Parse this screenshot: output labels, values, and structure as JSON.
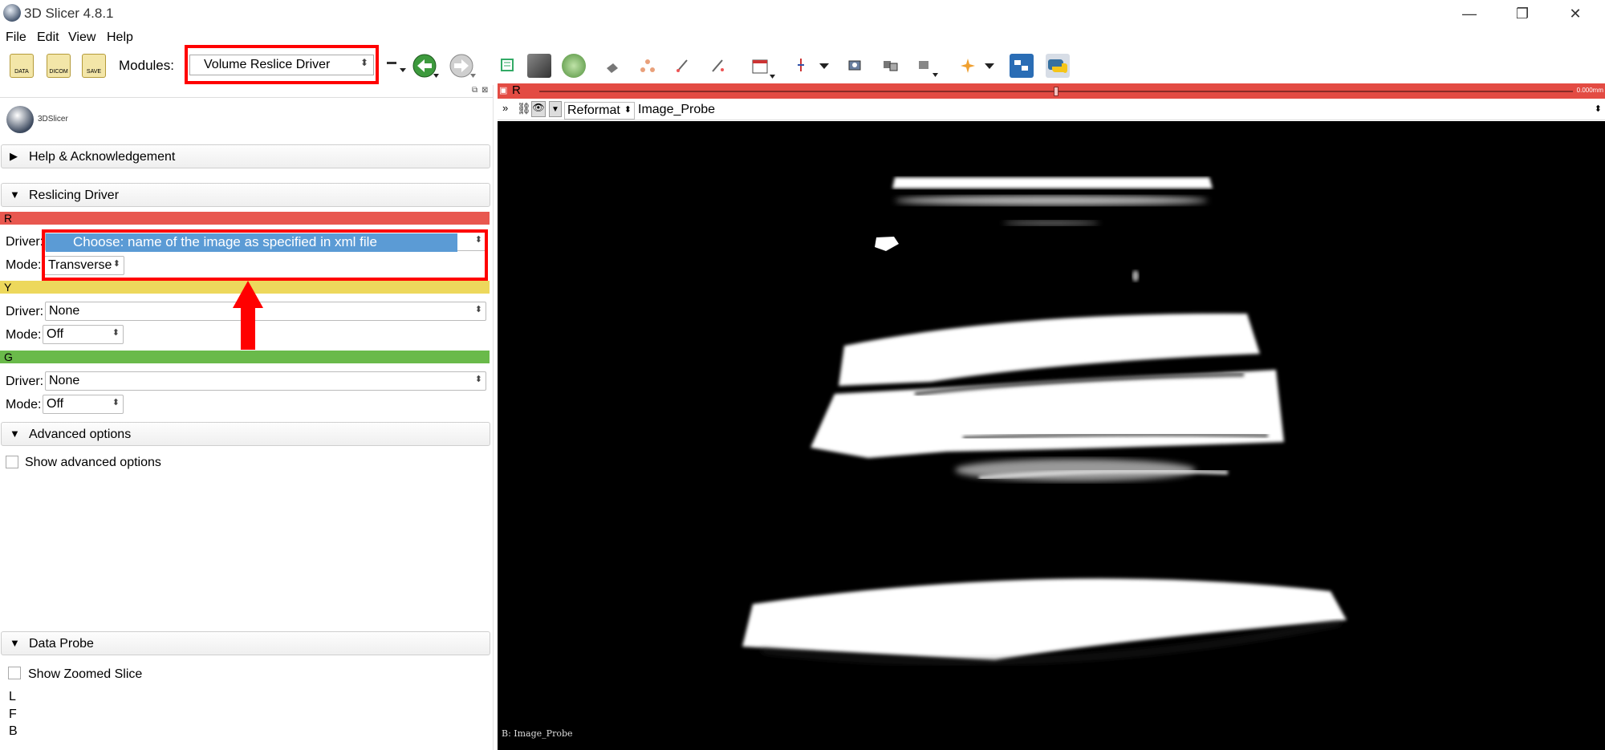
{
  "window": {
    "title": "3D Slicer 4.8.1",
    "minimize_glyph": "—",
    "maximize_glyph": "❐",
    "close_glyph": "✕"
  },
  "menu": [
    "File",
    "Edit",
    "View",
    "Help"
  ],
  "toolbar": {
    "modules_label": "Modules:",
    "module_selected": "Volume Reslice Driver",
    "icons": [
      "data-icon",
      "dicom-icon",
      "save-icon",
      "history-icon",
      "back-icon",
      "forward-icon",
      "data-module-icon",
      "volumes-icon",
      "models-icon",
      "transforms-icon",
      "markups-icon",
      "editor-icon",
      "segment-icon",
      "layout-icon",
      "crosshair-icon",
      "screenshot-icon",
      "scene-view-icon",
      "fiducial-icon",
      "extensions-icon",
      "python-icon"
    ],
    "icon_labels": {
      "data": "DATA",
      "dicom": "DICOM",
      "save": "SAVE"
    },
    "colors": {
      "highlight": "#ff0000",
      "back_button": "#2e8b2e"
    }
  },
  "panel": {
    "logo_text": "3DSlicer",
    "sections": {
      "help": "Help & Acknowledgement",
      "reslicing": "Reslicing Driver",
      "advanced": "Advanced options",
      "data_probe": "Data Probe"
    },
    "red": {
      "letter": "R",
      "color": "#e8574f",
      "driver_label": "Driver:",
      "driver_value": "",
      "mode_label": "Mode:",
      "mode_value": "Transverse"
    },
    "yellow": {
      "letter": "Y",
      "color": "#edd85c",
      "driver_label": "Driver:",
      "driver_value": "None",
      "mode_label": "Mode:",
      "mode_value": "Off"
    },
    "green": {
      "letter": "G",
      "color": "#6aba4a",
      "driver_label": "Driver:",
      "driver_value": "None",
      "mode_label": "Mode:",
      "mode_value": "Off"
    },
    "advanced_checkbox": "Show advanced options",
    "zoomed_checkbox": "Show Zoomed Slice",
    "probe_lines": [
      "L",
      "F",
      "B"
    ]
  },
  "annotation": {
    "callout_text": "Choose: name of the image as specified in xml file",
    "callout_color": "#5b9bd5",
    "arrow_color": "#ff0000"
  },
  "view": {
    "bar_letter": "R",
    "bar_color": "#e34b43",
    "offset_text": "0.000mm",
    "orientation": "Reformat",
    "volume": "Image_Probe",
    "caption": "B: Image_Probe"
  }
}
